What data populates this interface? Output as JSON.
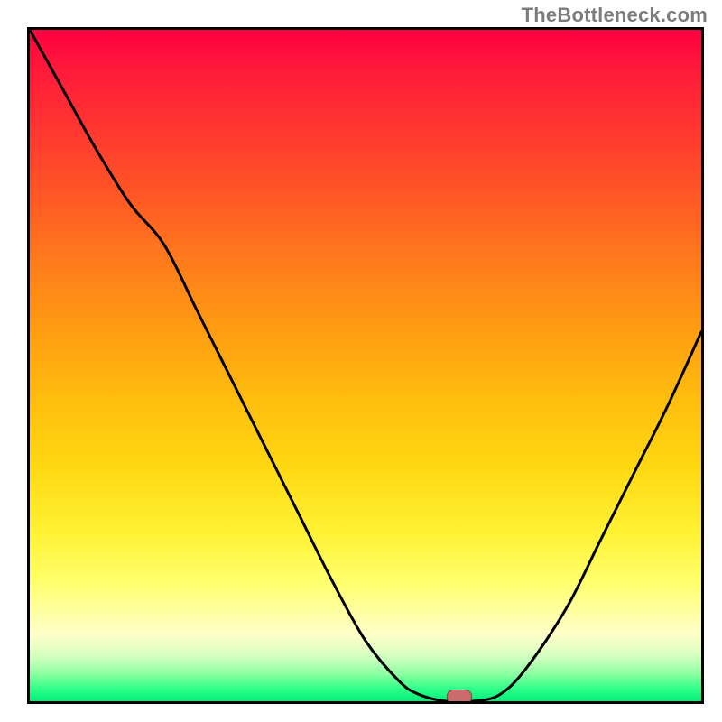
{
  "watermark": "TheBottleneck.com",
  "chart_data": {
    "type": "line",
    "x": [
      0.0,
      0.05,
      0.1,
      0.15,
      0.2,
      0.25,
      0.3,
      0.35,
      0.4,
      0.45,
      0.5,
      0.55,
      0.58,
      0.62,
      0.66,
      0.7,
      0.74,
      0.8,
      0.85,
      0.9,
      0.95,
      1.0
    ],
    "values": [
      1.0,
      0.91,
      0.82,
      0.74,
      0.68,
      0.58,
      0.48,
      0.38,
      0.28,
      0.18,
      0.09,
      0.03,
      0.01,
      0.0,
      0.0,
      0.01,
      0.05,
      0.14,
      0.24,
      0.34,
      0.44,
      0.55
    ],
    "title": "",
    "xlabel": "",
    "ylabel": "",
    "xlim": [
      0,
      1
    ],
    "ylim": [
      0,
      1
    ],
    "grid": false,
    "marker": {
      "x": 0.64,
      "y": 0.0
    },
    "background_gradient": {
      "top": "#ff0040",
      "mid": "#ffd812",
      "bottom": "#00f07a"
    }
  }
}
